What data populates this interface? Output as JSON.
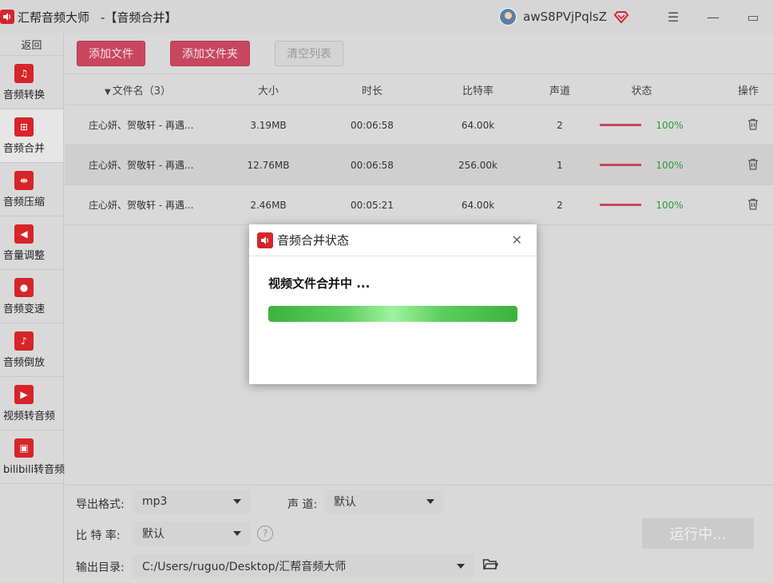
{
  "titlebar": {
    "app_name": "汇帮音频大师",
    "subtitle": "-【音频合并】",
    "username": "awS8PVjPqlsZ",
    "menu_glyph": "☰",
    "minimize_glyph": "—",
    "maximize_glyph": "▭"
  },
  "sidebar": {
    "back_label": "返回",
    "items": [
      {
        "label": "音频转换",
        "icon": "audio-convert-icon"
      },
      {
        "label": "音频合并",
        "icon": "audio-merge-icon",
        "active": true
      },
      {
        "label": "音频压缩",
        "icon": "audio-compress-icon"
      },
      {
        "label": "音量调整",
        "icon": "volume-adjust-icon"
      },
      {
        "label": "音频变速",
        "icon": "audio-speed-icon"
      },
      {
        "label": "音频倒放",
        "icon": "audio-reverse-icon"
      },
      {
        "label": "视频转音频",
        "icon": "video-to-audio-icon"
      },
      {
        "label": "bilibili转音频",
        "icon": "bilibili-icon"
      }
    ]
  },
  "toolbar": {
    "add_file": "添加文件",
    "add_folder": "添加文件夹",
    "clear_list": "清空列表"
  },
  "table": {
    "headers": {
      "name": "文件名（3）",
      "size": "大小",
      "duration": "时长",
      "bitrate": "比特率",
      "channels": "声道",
      "status": "状态",
      "actions": "操作"
    },
    "rows": [
      {
        "name": "庄心妍、贺敬轩 - 再遇...",
        "size": "3.19MB",
        "duration": "00:06:58",
        "bitrate": "64.00k",
        "channels": "2",
        "progress": "100%"
      },
      {
        "name": "庄心妍、贺敬轩 - 再遇...",
        "size": "12.76MB",
        "duration": "00:06:58",
        "bitrate": "256.00k",
        "channels": "1",
        "progress": "100%"
      },
      {
        "name": "庄心妍、贺敬轩 - 再遇...",
        "size": "2.46MB",
        "duration": "00:05:21",
        "bitrate": "64.00k",
        "channels": "2",
        "progress": "100%"
      }
    ]
  },
  "settings": {
    "format_label": "导出格式:",
    "format_value": "mp3",
    "channel_label": "声 道:",
    "channel_value": "默认",
    "bitrate_label": "比 特 率:",
    "bitrate_value": "默认",
    "output_label": "输出目录:",
    "output_value": "C:/Users/ruguo/Desktop/汇帮音频大师",
    "help_glyph": "?",
    "run_label": "运行中..."
  },
  "modal": {
    "title": "音频合并状态",
    "close_glyph": "✕",
    "message": "视频文件合并中 ...",
    "progress": 1.0
  },
  "colors": {
    "brand_red": "#d7242a",
    "button_red": "#c8475f",
    "status_green": "#2a9d3a",
    "progress_green": "#3bb33b"
  }
}
